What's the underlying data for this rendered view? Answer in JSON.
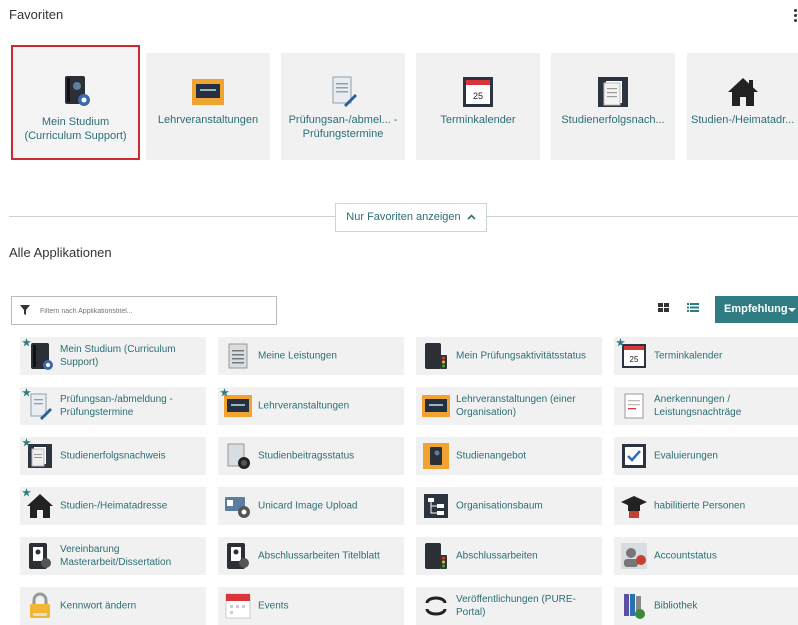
{
  "favorites": {
    "title": "Favoriten",
    "tiles": [
      {
        "label": "Mein Studium (Curriculum Support)",
        "icon": "book-gear-icon"
      },
      {
        "label": "Lehrveranstaltungen",
        "icon": "chalkboard-icon"
      },
      {
        "label": "Prüfungsan-/abmel... - Prüfungstermine",
        "icon": "document-pen-icon"
      },
      {
        "label": "Terminkalender",
        "icon": "calendar-icon"
      },
      {
        "label": "Studienerfolgsnach...",
        "icon": "documents-icon"
      },
      {
        "label": "Studien-/Heimatadr...",
        "icon": "house-icon"
      }
    ],
    "toggle_label": "Nur Favoriten anzeigen"
  },
  "apps": {
    "title": "Alle Applikationen",
    "filter_placeholder": "Filtern nach Applikationstitel...",
    "sort_label": "Empfehlung",
    "items": [
      {
        "label": "Mein Studium (Curriculum Support)",
        "icon": "book-gear-icon",
        "favorite": true
      },
      {
        "label": "Meine Leistungen",
        "icon": "document-list-icon",
        "favorite": false
      },
      {
        "label": "Mein Prüfungsaktivitätsstatus",
        "icon": "book-traffic-light-icon",
        "favorite": false
      },
      {
        "label": "Terminkalender",
        "icon": "calendar-icon",
        "favorite": true
      },
      {
        "label": "Prüfungsan-/abmeldung - Prüfungstermine",
        "icon": "document-pen-icon",
        "favorite": true
      },
      {
        "label": "Lehrveranstaltungen",
        "icon": "chalkboard-icon",
        "favorite": true
      },
      {
        "label": "Lehrveranstaltungen (einer Organisation)",
        "icon": "chalkboard-icon",
        "favorite": false
      },
      {
        "label": "Anerkennungen / Leistungsnachträge",
        "icon": "document-check-icon",
        "favorite": false
      },
      {
        "label": "Studienerfolgsnachweis",
        "icon": "documents-icon",
        "favorite": true
      },
      {
        "label": "Studienbeitragsstatus",
        "icon": "coins-document-icon",
        "favorite": false
      },
      {
        "label": "Studienangebot",
        "icon": "book-orange-icon",
        "favorite": false
      },
      {
        "label": "Evaluierungen",
        "icon": "checkmark-board-icon",
        "favorite": false
      },
      {
        "label": "Studien-/Heimatadresse",
        "icon": "house-icon",
        "favorite": true
      },
      {
        "label": "Unicard Image Upload",
        "icon": "id-card-gear-icon",
        "favorite": false
      },
      {
        "label": "Organisationsbaum",
        "icon": "org-tree-icon",
        "favorite": false
      },
      {
        "label": "habilitierte Personen",
        "icon": "graduate-cap-icon",
        "favorite": false
      },
      {
        "label": "Vereinbarung Masterarbeit/Dissertation",
        "icon": "book-person-icon",
        "favorite": false
      },
      {
        "label": "Abschlussarbeiten Titelblatt",
        "icon": "book-person-icon",
        "favorite": false
      },
      {
        "label": "Abschlussarbeiten",
        "icon": "book-traffic-light-icon",
        "favorite": false
      },
      {
        "label": "Accountstatus",
        "icon": "user-check-icon",
        "favorite": false
      },
      {
        "label": "Kennwort ändern",
        "icon": "padlock-icon",
        "favorite": false
      },
      {
        "label": "Events",
        "icon": "events-calendar-icon",
        "favorite": false
      },
      {
        "label": "Veröffentlichungen (PURE-Portal)",
        "icon": "pure-logo-icon",
        "favorite": false
      },
      {
        "label": "Bibliothek",
        "icon": "books-globe-icon",
        "favorite": false
      }
    ]
  },
  "colors": {
    "accent": "#2a6f76",
    "button": "#2f7c82",
    "selected_border": "#cc2a30",
    "star": "#2f7c82"
  }
}
